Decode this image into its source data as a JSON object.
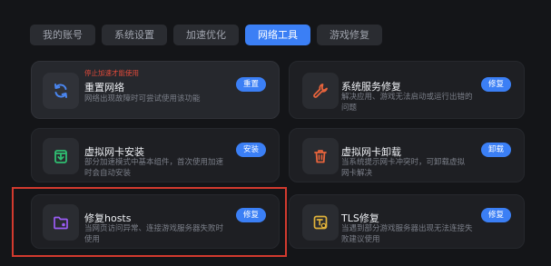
{
  "tabs": [
    {
      "label": "我的账号",
      "active": false
    },
    {
      "label": "系统设置",
      "active": false
    },
    {
      "label": "加速优化",
      "active": false
    },
    {
      "label": "网络工具",
      "active": true
    },
    {
      "label": "游戏修复",
      "active": false
    }
  ],
  "cards": {
    "reset_network": {
      "warning": "停止加速才能使用",
      "title": "重置网络",
      "desc": "网络出现故障时可尝试使用该功能",
      "button": "重置",
      "icon": "refresh-icon",
      "icon_color": "#4a86f0"
    },
    "system_service": {
      "title": "系统服务修复",
      "desc": "解决应用、游戏无法启动或运行出错的问题",
      "button": "修复",
      "icon": "wrench-icon",
      "icon_color": "#e8643c"
    },
    "vnic_install": {
      "title": "虚拟网卡安装",
      "desc": "部分加速模式中基本组件，首次使用加速时会自动安装",
      "button": "安装",
      "icon": "download-box-icon",
      "icon_color": "#2fbf71"
    },
    "vnic_uninstall": {
      "title": "虚拟网卡卸载",
      "desc": "当系统提示网卡冲突时，可卸载虚拟网卡解决",
      "button": "卸载",
      "icon": "trash-icon",
      "icon_color": "#e8643c"
    },
    "fix_hosts": {
      "title": "修复hosts",
      "desc": "当网页访问异常、连接游戏服务器失败时使用",
      "button": "修复",
      "icon": "folder-gear-icon",
      "icon_color": "#9b5cf5"
    },
    "tls_fix": {
      "title": "TLS修复",
      "desc": "当遇到部分游戏服务器出现无法连接失败建议使用",
      "button": "修复",
      "icon": "tls-doc-icon",
      "icon_color": "#e0b23a"
    }
  }
}
